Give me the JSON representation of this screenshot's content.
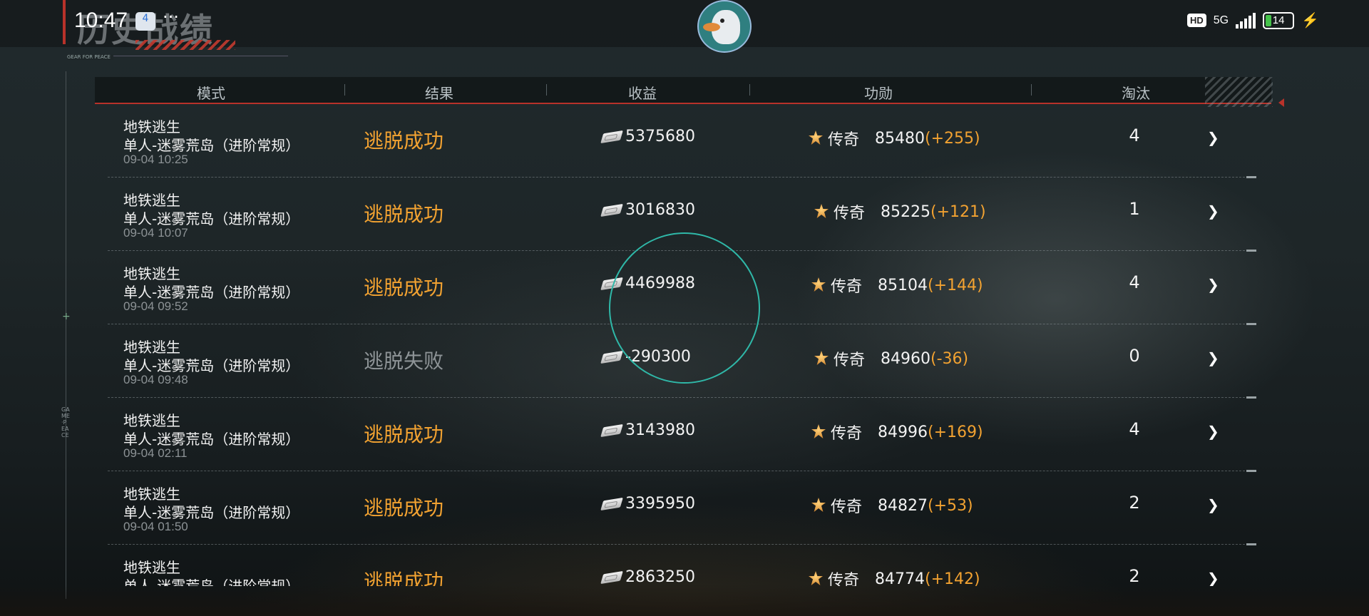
{
  "status_bar": {
    "time": "10:47",
    "notification_badge": "4",
    "more": "···",
    "hd": "HD",
    "network": "5G",
    "battery": "14"
  },
  "page": {
    "title": "历史战绩",
    "subtitle": "GEAR FOR PEACE",
    "rail_text": "GAME·PEACE"
  },
  "columns": {
    "mode": "模式",
    "result": "结果",
    "earnings": "收益",
    "merit": "功勋",
    "eliminations": "淘汰"
  },
  "rows": [
    {
      "map": "地铁逃生",
      "mode": "单人-迷雾荒岛（进阶常规）",
      "time": "09-04 10:25",
      "result": "逃脱成功",
      "success": true,
      "earnings": "5375680",
      "rank": "传奇",
      "merit": "85480",
      "delta": "(+255)",
      "kills": "4"
    },
    {
      "map": "地铁逃生",
      "mode": "单人-迷雾荒岛（进阶常规）",
      "time": "09-04 10:07",
      "result": "逃脱成功",
      "success": true,
      "earnings": "3016830",
      "rank": "传奇",
      "merit": "85225",
      "delta": "(+121)",
      "kills": "1"
    },
    {
      "map": "地铁逃生",
      "mode": "单人-迷雾荒岛（进阶常规）",
      "time": "09-04 09:52",
      "result": "逃脱成功",
      "success": true,
      "earnings": "4469988",
      "rank": "传奇",
      "merit": "85104",
      "delta": "(+144)",
      "kills": "4"
    },
    {
      "map": "地铁逃生",
      "mode": "单人-迷雾荒岛（进阶常规）",
      "time": "09-04 09:48",
      "result": "逃脱失败",
      "success": false,
      "earnings": "-290300",
      "rank": "传奇",
      "merit": "84960",
      "delta": "(-36)",
      "kills": "0"
    },
    {
      "map": "地铁逃生",
      "mode": "单人-迷雾荒岛（进阶常规）",
      "time": "09-04 02:11",
      "result": "逃脱成功",
      "success": true,
      "earnings": "3143980",
      "rank": "传奇",
      "merit": "84996",
      "delta": "(+169)",
      "kills": "4"
    },
    {
      "map": "地铁逃生",
      "mode": "单人-迷雾荒岛（进阶常规）",
      "time": "09-04 01:50",
      "result": "逃脱成功",
      "success": true,
      "earnings": "3395950",
      "rank": "传奇",
      "merit": "84827",
      "delta": "(+53)",
      "kills": "2"
    },
    {
      "map": "地铁逃生",
      "mode": "单人-迷雾荒岛（进阶常规）",
      "time": "",
      "result": "逃脱成功",
      "success": true,
      "earnings": "2863250",
      "rank": "传奇",
      "merit": "84774",
      "delta": "(+142)",
      "kills": "2"
    }
  ],
  "colors": {
    "accent_red": "#b8322a",
    "success_orange": "#f2a231",
    "fail_gray": "#8e9497"
  },
  "icons": {
    "earnings": "cash-icon",
    "rank": "legend-rank-badge-icon",
    "detail": "chevron-right-icon"
  }
}
